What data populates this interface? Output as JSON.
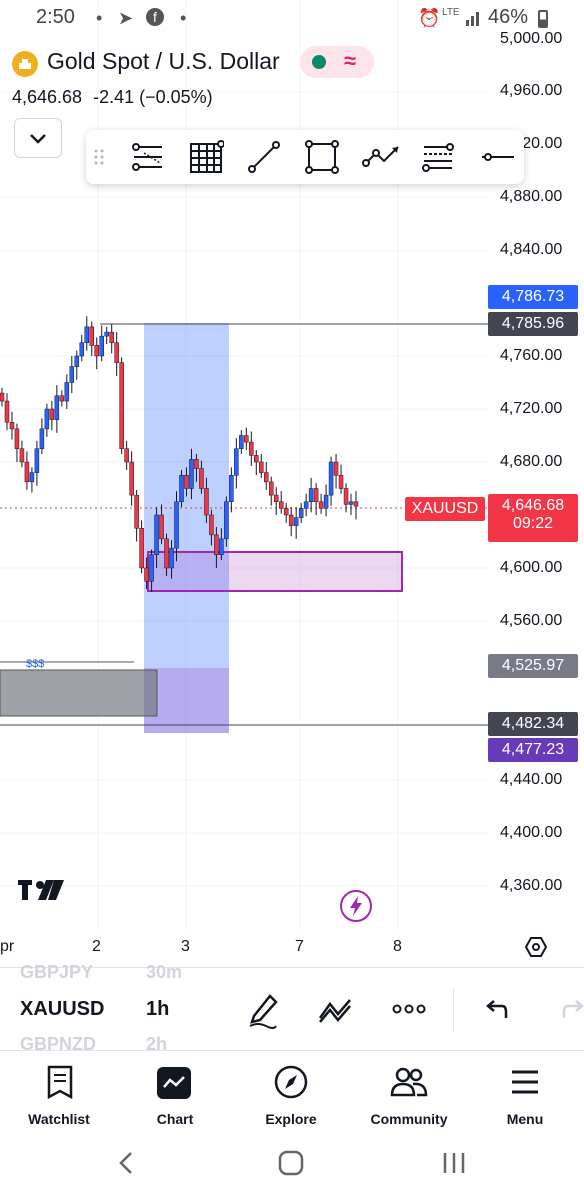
{
  "status_bar": {
    "time": "2:50",
    "network": "LTE",
    "battery": "46%"
  },
  "header": {
    "title": "Gold Spot / U.S. Dollar",
    "price": "4,646.68",
    "change": "-2.41 (−0.05%)",
    "market_status_color": "#0b8a6a",
    "accent_pill_color": "#fde3ea"
  },
  "drawing_toolbar": {
    "tools": [
      "trend-angle-icon",
      "grid-icon",
      "trend-line-icon",
      "rectangle-icon",
      "path-icon",
      "fib-icon",
      "horizontal-line-icon"
    ]
  },
  "price_axis": {
    "labels": [
      "5,000.00",
      "4,960.00",
      "4,920.00",
      "4,880.00",
      "4,840.00",
      "4,760.00",
      "4,720.00",
      "4,680.00",
      "4,600.00",
      "4,560.00",
      "4,440.00",
      "4,400.00",
      "4,360.00"
    ],
    "tags": [
      {
        "value": "4,786.73",
        "color": "#2962ff"
      },
      {
        "value": "4,785.96",
        "color": "#434651"
      },
      {
        "value": "4,525.97",
        "color": "#787b86"
      },
      {
        "value": "4,482.34",
        "color": "#434651"
      },
      {
        "value": "4,477.23",
        "color": "#673ab7"
      }
    ],
    "current": {
      "symbol": "XAUUSD",
      "price": "4,646.68",
      "countdown": "09:22",
      "color": "#f23645"
    }
  },
  "time_axis": {
    "labels": [
      "pr",
      "2",
      "3",
      "7",
      "8"
    ]
  },
  "chart_labels": {
    "liquidity": "$$$"
  },
  "chart_data": {
    "type": "candlestick",
    "symbol": "XAUUSD",
    "interval": "1h",
    "ylim": [
      4340,
      5000
    ],
    "x_ticks": [
      "pr",
      "2",
      "3",
      "7",
      "8"
    ],
    "horizontal_levels": [
      4785.96,
      4482.34
    ],
    "zones": [
      {
        "kind": "blue",
        "y": [
          4477.23,
          4786.73
        ]
      },
      {
        "kind": "purple",
        "y": [
          4582,
          4612
        ]
      },
      {
        "kind": "purple",
        "y": [
          4477.23,
          4525.97
        ]
      },
      {
        "kind": "gray",
        "y": [
          4490,
          4520
        ]
      }
    ],
    "last_price": 4646.68,
    "closes": [
      4726,
      4710,
      4705,
      4690,
      4680,
      4665,
      4672,
      4690,
      4705,
      4720,
      4712,
      4730,
      4726,
      4740,
      4752,
      4760,
      4770,
      4782,
      4768,
      4760,
      4775,
      4778,
      4770,
      4755,
      4690,
      4680,
      4655,
      4630,
      4600,
      4590,
      4610,
      4640,
      4622,
      4600,
      4615,
      4650,
      4670,
      4660,
      4682,
      4675,
      4660,
      4640,
      4625,
      4610,
      4622,
      4650,
      4670,
      4690,
      4700,
      4695,
      4685,
      4680,
      4672,
      4665,
      4655,
      4650,
      4645,
      4640,
      4632,
      4638,
      4645,
      4650,
      4660,
      4650,
      4645,
      4655,
      4680,
      4670,
      4660,
      4648,
      4650,
      4646.68
    ]
  },
  "symbol_row": {
    "prev_symbol": "GBPJPY",
    "prev_interval": "30m",
    "symbol": "XAUUSD",
    "interval": "1h",
    "next_symbol": "GBPNZD",
    "next_interval": "2h"
  },
  "bottom_nav": {
    "items": [
      {
        "label": "Watchlist",
        "icon": "watchlist-icon"
      },
      {
        "label": "Chart",
        "icon": "chart-icon"
      },
      {
        "label": "Explore",
        "icon": "compass-icon"
      },
      {
        "label": "Community",
        "icon": "community-icon"
      },
      {
        "label": "Menu",
        "icon": "menu-icon"
      }
    ]
  }
}
